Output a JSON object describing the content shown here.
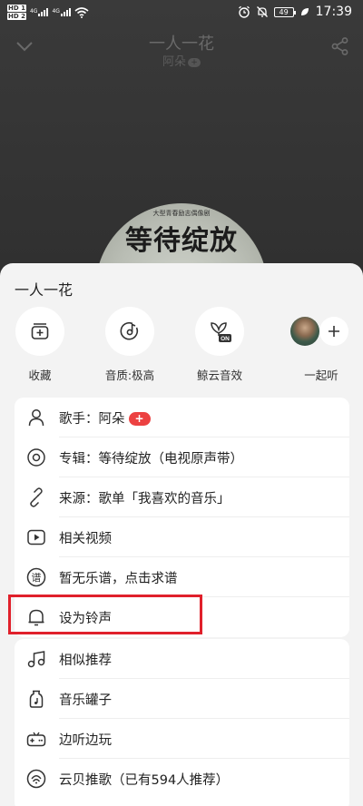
{
  "status_bar": {
    "hd1": "HD 1",
    "hd2": "HD 2",
    "sig1": "4G",
    "sig2": "4G",
    "battery": "49",
    "time": "17:39"
  },
  "player": {
    "song_title": "一人一花",
    "artist": "阿朵",
    "album_art_subtitle": "大型青春励志偶像剧",
    "album_art_title": "等待绽放"
  },
  "sheet": {
    "title": "一人一花",
    "actions": [
      {
        "label": "收藏",
        "icon": "add-to-playlist-icon"
      },
      {
        "label": "音质:极高",
        "icon": "sound-quality-icon"
      },
      {
        "label": "鲸云音效",
        "icon": "whale-audio-effect-icon",
        "badge": "ON"
      },
      {
        "label": "一起听",
        "icon": "listen-together-icon"
      }
    ],
    "info_rows": [
      {
        "label": "歌手：阿朵",
        "icon": "singer-icon",
        "badge": "+"
      },
      {
        "label": "专辑：等待绽放（电视原声带）",
        "icon": "album-disc-icon"
      },
      {
        "label": "来源：歌单「我喜欢的音乐」",
        "icon": "link-icon"
      },
      {
        "label": "相关视频",
        "icon": "video-play-icon"
      },
      {
        "label": "暂无乐谱，点击求谱",
        "icon": "sheet-music-icon",
        "icon_char": "谱"
      },
      {
        "label": "设为铃声",
        "icon": "bell-icon"
      }
    ],
    "more_rows": [
      {
        "label": "相似推荐",
        "icon": "similar-music-icon"
      },
      {
        "label": "音乐罐子",
        "icon": "music-jar-icon"
      },
      {
        "label": "边听边玩",
        "icon": "gamepad-icon"
      },
      {
        "label": "云贝推歌（已有594人推荐）",
        "icon": "cloud-shell-icon"
      }
    ]
  },
  "colors": {
    "accent_red": "#ec4141",
    "highlight_red": "#e0202b"
  }
}
